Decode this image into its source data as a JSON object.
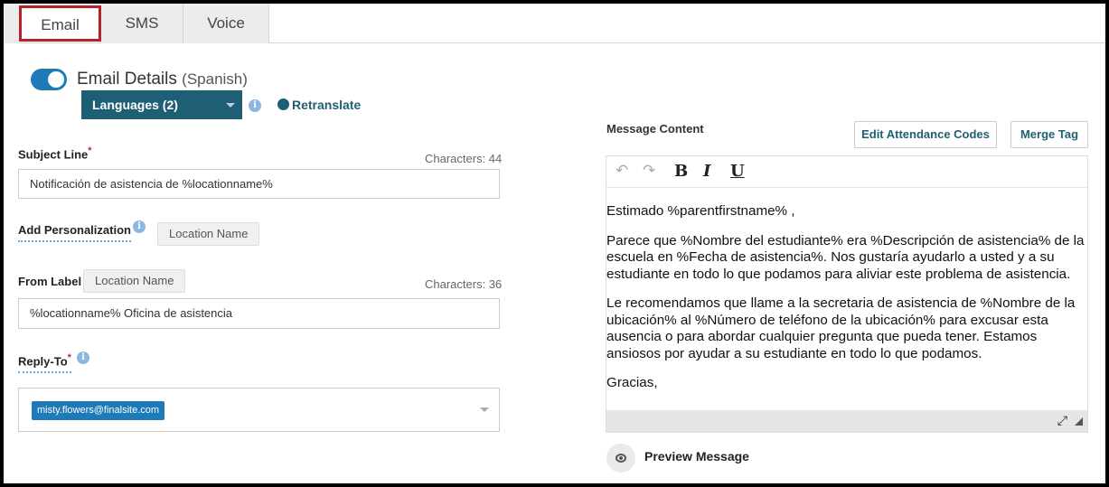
{
  "tabs": [
    {
      "label": "Email",
      "active": true
    },
    {
      "label": "SMS",
      "active": false
    },
    {
      "label": "Voice",
      "active": false
    }
  ],
  "details": {
    "title": "Email Details",
    "language_note": "(Spanish)",
    "toggle_on": true,
    "languages_label": "Languages (2)",
    "retranslate_label": "Retranslate"
  },
  "subject": {
    "label": "Subject Line",
    "required_mark": "*",
    "chars_label": "Characters: 44",
    "value": "Notificación de asistencia de %locationname%"
  },
  "personalization": {
    "label": "Add Personalization",
    "chip": "Location Name"
  },
  "from_label": {
    "label": "From Label",
    "chip": "Location Name",
    "chars_label": "Characters: 36",
    "value": "%locationname% Oficina de asistencia"
  },
  "reply_to": {
    "label": "Reply-To",
    "required_mark": "*",
    "tag": "misty.flowers@finalsite.com"
  },
  "message": {
    "title": "Message Content",
    "edit_codes_label": "Edit Attendance Codes",
    "merge_tag_label": "Merge Tag",
    "toolbar": {
      "bold": "B",
      "italic": "I",
      "underline": "U"
    },
    "paragraphs": [
      "Estimado %parentfirstname% ,",
      "Parece que %Nombre del estudiante% era %Descripción de asistencia% de la escuela en %Fecha de asistencia%. Nos gustaría ayudarlo a usted y a su estudiante en todo lo que podamos para aliviar este problema de asistencia.",
      "Le recomendamos que llame a la secretaria de asistencia de %Nombre de la ubicación% al %Número de teléfono de la ubicación% para excusar esta ausencia o para abordar cualquier pregunta que pueda tener. Estamos ansiosos por ayudar a su estudiante en todo lo que podamos.",
      "Gracias,"
    ],
    "preview_label": "Preview Message"
  },
  "icons": {
    "info": "info-icon",
    "globe": "globe-icon",
    "eye": "eye-icon",
    "expand": "expand-icon"
  },
  "colors": {
    "accent": "#1f7ab8",
    "dark_teal": "#1f5f73",
    "active_tab_border": "#b5222a",
    "required": "#c0262d"
  }
}
